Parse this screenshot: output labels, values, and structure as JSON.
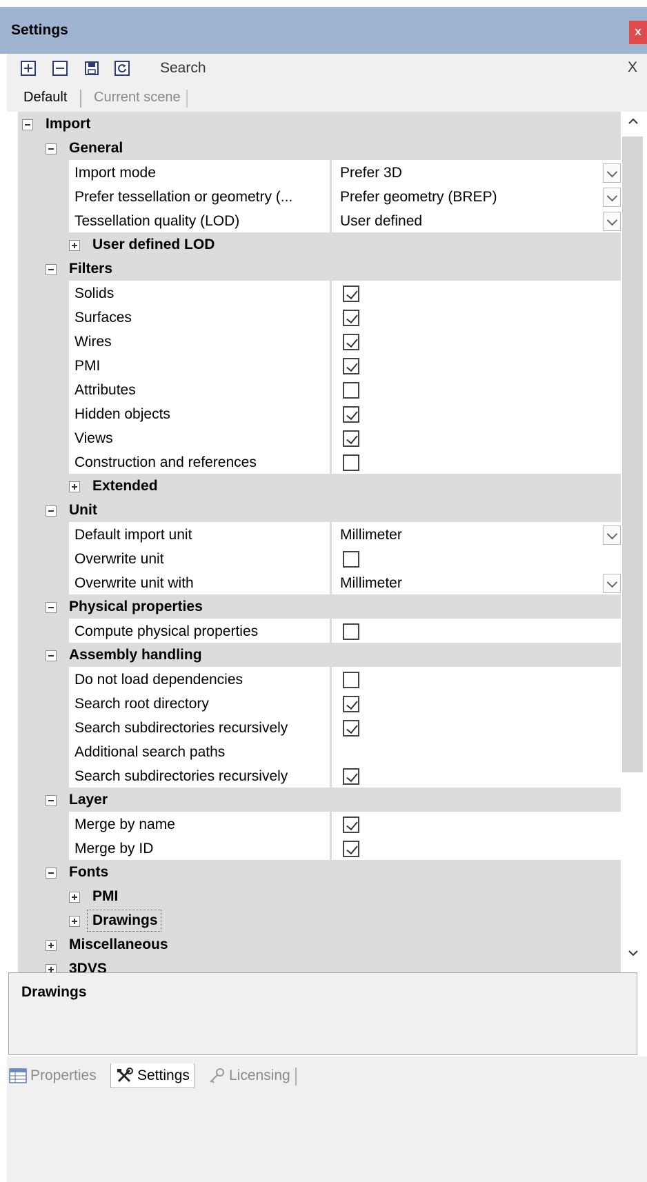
{
  "window": {
    "title": "Settings",
    "close_label": "x"
  },
  "toolbar": {
    "icons": [
      "expand-all-icon",
      "collapse-all-icon",
      "save-icon",
      "reset-icon"
    ],
    "search_label": "Search",
    "clear_label": "X"
  },
  "tabs": {
    "active": "Default",
    "inactive": "Current scene"
  },
  "tree": {
    "import": "Import",
    "general": {
      "label": "General",
      "import_mode": {
        "name": "Import mode",
        "value": "Prefer 3D"
      },
      "prefer_tess": {
        "name": "Prefer tessellation or geometry (...",
        "value": "Prefer geometry (BREP)"
      },
      "tess_quality": {
        "name": "Tessellation quality (LOD)",
        "value": "User defined"
      },
      "user_lod": "User defined LOD"
    },
    "filters": {
      "label": "Filters",
      "items": [
        {
          "name": "Solids",
          "checked": true
        },
        {
          "name": "Surfaces",
          "checked": true
        },
        {
          "name": "Wires",
          "checked": true
        },
        {
          "name": "PMI",
          "checked": true
        },
        {
          "name": "Attributes",
          "checked": false
        },
        {
          "name": "Hidden objects",
          "checked": true
        },
        {
          "name": "Views",
          "checked": true
        },
        {
          "name": "Construction and references",
          "checked": false
        }
      ],
      "extended": "Extended"
    },
    "unit": {
      "label": "Unit",
      "default_unit": {
        "name": "Default import unit",
        "value": "Millimeter"
      },
      "overwrite": {
        "name": "Overwrite unit",
        "checked": false
      },
      "overwrite_with": {
        "name": "Overwrite unit with",
        "value": "Millimeter"
      }
    },
    "physical": {
      "label": "Physical properties",
      "compute": {
        "name": "Compute physical properties",
        "checked": false
      }
    },
    "assembly": {
      "label": "Assembly handling",
      "no_deps": {
        "name": "Do not load dependencies",
        "checked": false
      },
      "root_dir": {
        "name": "Search root directory",
        "checked": true
      },
      "subdirs1": {
        "name": "Search subdirectories recursively",
        "checked": true
      },
      "add_paths": {
        "name": "Additional search paths",
        "value": ""
      },
      "subdirs2": {
        "name": "Search subdirectories recursively",
        "checked": true
      }
    },
    "layer": {
      "label": "Layer",
      "by_name": {
        "name": "Merge by name",
        "checked": true
      },
      "by_id": {
        "name": "Merge by ID",
        "checked": true
      }
    },
    "fonts": {
      "label": "Fonts",
      "pmi": "PMI",
      "drawings": "Drawings"
    },
    "misc": "Miscellaneous",
    "vs3d": "3DVS"
  },
  "description": {
    "title": "Drawings"
  },
  "bottom_tabs": {
    "properties": "Properties",
    "settings": "Settings",
    "licensing": "Licensing"
  }
}
